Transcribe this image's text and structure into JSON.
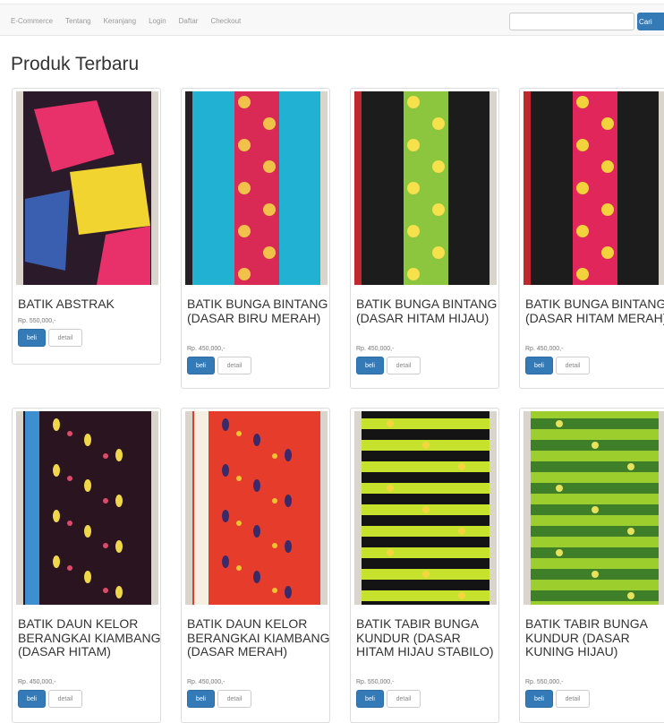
{
  "nav": {
    "items": [
      {
        "label": "E-Commerce"
      },
      {
        "label": "Tentang"
      },
      {
        "label": "Keranjang"
      },
      {
        "label": "Login"
      },
      {
        "label": "Daftar"
      },
      {
        "label": "Checkout"
      }
    ],
    "search_value": "",
    "search_button": "Cari"
  },
  "main": {
    "title": "Produk Terbaru",
    "products": [
      {
        "name": "BATIK ABSTRAK",
        "price": "Rp. 550,000,-",
        "buy": "beli",
        "detail": "detail",
        "colors": [
          "#2a1a2a",
          "#e8306a",
          "#f2d431",
          "#3b5fb0"
        ]
      },
      {
        "name": "BATIK BUNGA BINTANG (DASAR BIRU MERAH)",
        "price": "Rp. 450,000,-",
        "buy": "beli",
        "detail": "detail",
        "colors": [
          "#21b2d3",
          "#d92a55",
          "#f2c14a",
          "#222222"
        ]
      },
      {
        "name": "BATIK BUNGA BINTANG (DASAR HITAM HIJAU)",
        "price": "Rp. 450,000,-",
        "buy": "beli",
        "detail": "detail",
        "colors": [
          "#1c1c1c",
          "#8cc63f",
          "#f6e04c",
          "#c0282f"
        ]
      },
      {
        "name": "BATIK BUNGA BINTANG (DASAR HITAM MERAH)",
        "price": "Rp. 450,000,-",
        "buy": "beli",
        "detail": "detail",
        "colors": [
          "#1c1c1c",
          "#e0265a",
          "#f3d33c",
          "#c0282f"
        ]
      },
      {
        "name": "BATIK DAUN KELOR BERANGKAI KIAMBANG (DASAR HITAM)",
        "price": "Rp. 450,000,-",
        "buy": "beli",
        "detail": "detail",
        "colors": [
          "#2a1420",
          "#f0d74a",
          "#e04a6a",
          "#3e8fcf"
        ]
      },
      {
        "name": "BATIK DAUN KELOR BERANGKAI KIAMBANG (DASAR MERAH)",
        "price": "Rp. 450,000,-",
        "buy": "beli",
        "detail": "detail",
        "colors": [
          "#e63c2b",
          "#3b2a6a",
          "#f2c232",
          "#f5f0e0"
        ]
      },
      {
        "name": "BATIK TABIR BUNGA KUNDUR (DASAR HITAM HIJAU STABILO)",
        "price": "Rp. 550,000,-",
        "buy": "beli",
        "detail": "detail",
        "colors": [
          "#141414",
          "#c6e22c",
          "#f4d640",
          "#d8d8d8"
        ]
      },
      {
        "name": "BATIK TABIR BUNGA KUNDUR (DASAR KUNING HIJAU)",
        "price": "Rp. 550,000,-",
        "buy": "beli",
        "detail": "detail",
        "colors": [
          "#9ccf2e",
          "#3f7f2a",
          "#e8e35a",
          "#c0282f"
        ]
      }
    ]
  }
}
